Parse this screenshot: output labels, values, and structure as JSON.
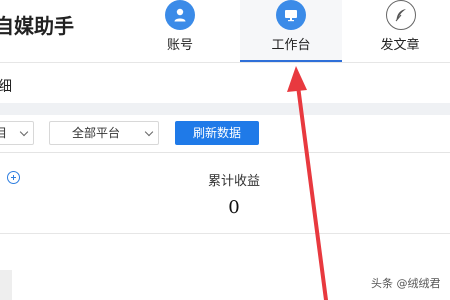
{
  "header": {
    "app_title": "自媒助手",
    "nav": [
      {
        "label": "账号",
        "icon": "user-icon"
      },
      {
        "label": "工作台",
        "icon": "monitor-icon",
        "active": true
      },
      {
        "label": "发文章",
        "icon": "feather-icon"
      }
    ]
  },
  "subheader": {
    "title": "细"
  },
  "filters": {
    "left_select": "目",
    "platform_select": "全部平台",
    "refresh_label": "刷新数据"
  },
  "stats": {
    "label": "累计收益",
    "value": "0"
  },
  "watermark": "头条 @绒绒君",
  "colors": {
    "accent": "#1f7ae8",
    "annotation_arrow": "#e8393f"
  }
}
